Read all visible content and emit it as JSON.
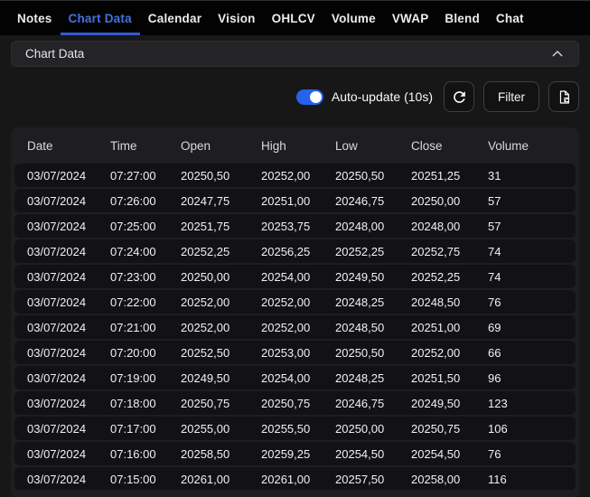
{
  "nav": {
    "tabs": [
      {
        "label": "Notes",
        "active": false
      },
      {
        "label": "Chart Data",
        "active": true
      },
      {
        "label": "Calendar",
        "active": false
      },
      {
        "label": "Vision",
        "active": false
      },
      {
        "label": "OHLCV",
        "active": false
      },
      {
        "label": "Volume",
        "active": false
      },
      {
        "label": "VWAP",
        "active": false
      },
      {
        "label": "Blend",
        "active": false
      },
      {
        "label": "Chat",
        "active": false
      }
    ]
  },
  "section": {
    "title": "Chart Data"
  },
  "toolbar": {
    "auto_update_label": "Auto-update (10s)",
    "auto_update_on": true,
    "filter_label": "Filter"
  },
  "icons": {
    "chevron": "chevron-up-icon",
    "refresh": "refresh-icon",
    "export": "file-export-icon"
  },
  "colors": {
    "accent_blue": "#2563eb",
    "active_tab": "#4272e0",
    "page_bg": "#171717",
    "table_bg": "#1e1e20",
    "row_bg": "#121214"
  },
  "table": {
    "columns": [
      "Date",
      "Time",
      "Open",
      "High",
      "Low",
      "Close",
      "Volume"
    ],
    "rows": [
      [
        "03/07/2024",
        "07:27:00",
        "20250,50",
        "20252,00",
        "20250,50",
        "20251,25",
        "31"
      ],
      [
        "03/07/2024",
        "07:26:00",
        "20247,75",
        "20251,00",
        "20246,75",
        "20250,00",
        "57"
      ],
      [
        "03/07/2024",
        "07:25:00",
        "20251,75",
        "20253,75",
        "20248,00",
        "20248,00",
        "57"
      ],
      [
        "03/07/2024",
        "07:24:00",
        "20252,25",
        "20256,25",
        "20252,25",
        "20252,75",
        "74"
      ],
      [
        "03/07/2024",
        "07:23:00",
        "20250,00",
        "20254,00",
        "20249,50",
        "20252,25",
        "74"
      ],
      [
        "03/07/2024",
        "07:22:00",
        "20252,00",
        "20252,00",
        "20248,25",
        "20248,50",
        "76"
      ],
      [
        "03/07/2024",
        "07:21:00",
        "20252,00",
        "20252,00",
        "20248,50",
        "20251,00",
        "69"
      ],
      [
        "03/07/2024",
        "07:20:00",
        "20252,50",
        "20253,00",
        "20250,50",
        "20252,00",
        "66"
      ],
      [
        "03/07/2024",
        "07:19:00",
        "20249,50",
        "20254,00",
        "20248,25",
        "20251,50",
        "96"
      ],
      [
        "03/07/2024",
        "07:18:00",
        "20250,75",
        "20250,75",
        "20246,75",
        "20249,50",
        "123"
      ],
      [
        "03/07/2024",
        "07:17:00",
        "20255,00",
        "20255,50",
        "20250,00",
        "20250,75",
        "106"
      ],
      [
        "03/07/2024",
        "07:16:00",
        "20258,50",
        "20259,25",
        "20254,50",
        "20254,50",
        "76"
      ],
      [
        "03/07/2024",
        "07:15:00",
        "20261,00",
        "20261,00",
        "20257,50",
        "20258,00",
        "116"
      ]
    ]
  }
}
